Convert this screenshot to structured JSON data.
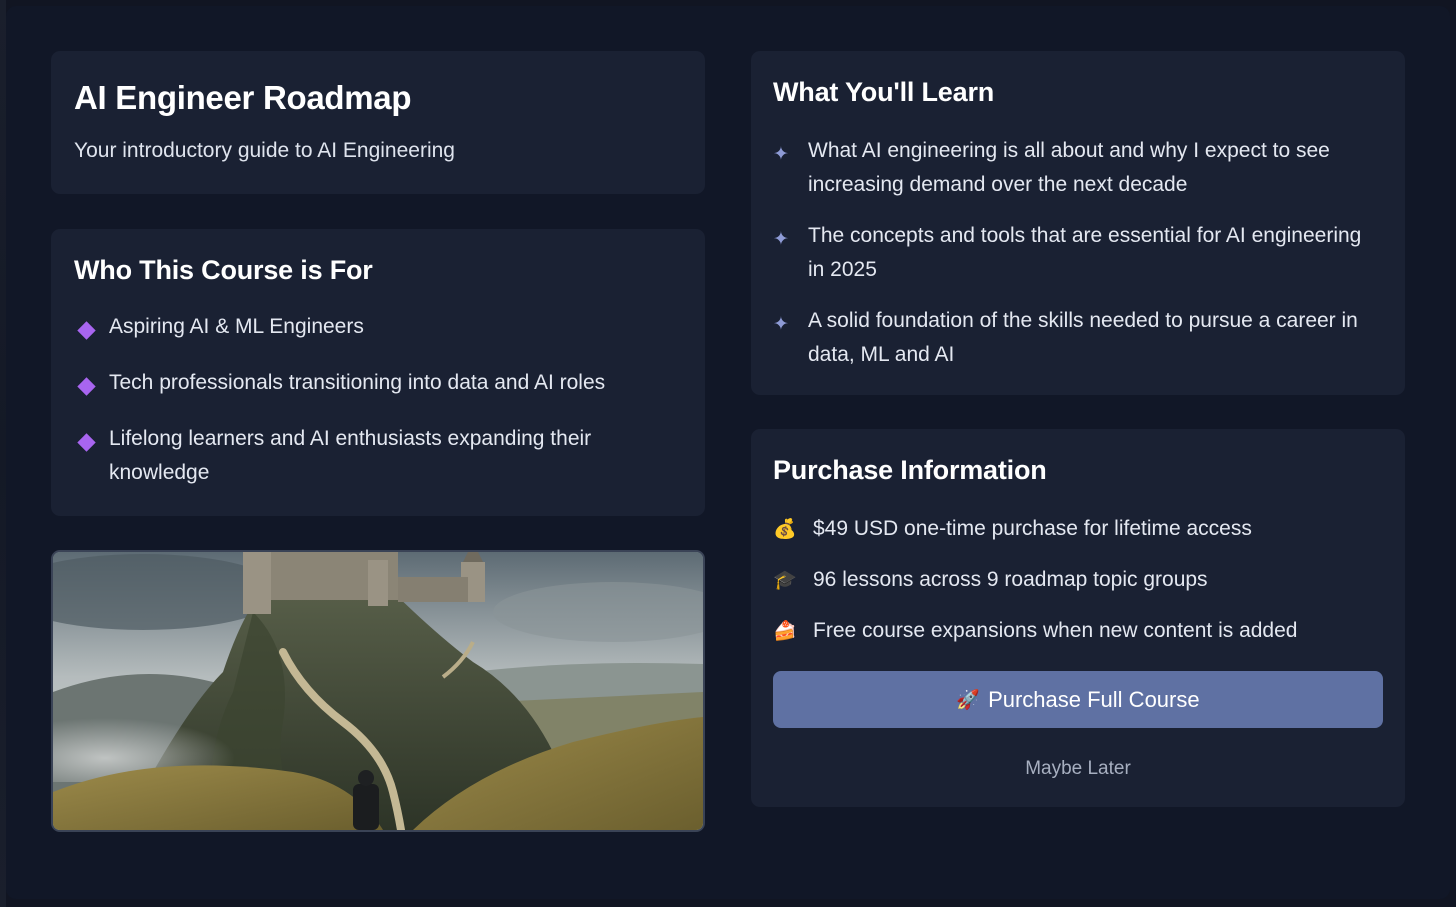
{
  "title_card": {
    "title": "AI Engineer Roadmap",
    "subtitle": "Your introductory guide to AI Engineering"
  },
  "who_card": {
    "heading": "Who This Course is For",
    "items": [
      {
        "text": "Aspiring AI & ML Engineers"
      },
      {
        "text": "Tech professionals transitioning into data and AI roles"
      },
      {
        "text": "Lifelong learners and AI enthusiasts expanding their knowledge"
      }
    ]
  },
  "learn_card": {
    "heading": "What You'll Learn",
    "items": [
      {
        "text": "What AI engineering is all about and why I expect to see increasing demand over the next decade"
      },
      {
        "text": "The concepts and tools that are essential for AI engineering in 2025"
      },
      {
        "text": "A solid foundation of the skills needed to pursue a career in data, ML and AI"
      }
    ]
  },
  "purchase_card": {
    "heading": "Purchase Information",
    "items": [
      {
        "icon": "money-bag-icon",
        "glyph": "💰",
        "text": "$49 USD one-time purchase for lifetime access"
      },
      {
        "icon": "graduation-cap-icon",
        "glyph": "🎓",
        "text": "96 lessons across 9 roadmap topic groups"
      },
      {
        "icon": "cake-icon",
        "glyph": "🍰",
        "text": "Free course expansions when new content is added"
      }
    ],
    "purchase_button": {
      "icon": "rocket-icon",
      "glyph": "🚀",
      "label": "Purchase Full Course"
    },
    "later_button": {
      "label": "Maybe Later"
    }
  },
  "colors": {
    "background": "#111727",
    "card": "#1a2133",
    "accent_diamond": "#a865f0",
    "sparkle": "#8e9bd6",
    "button": "#5f71a3"
  }
}
